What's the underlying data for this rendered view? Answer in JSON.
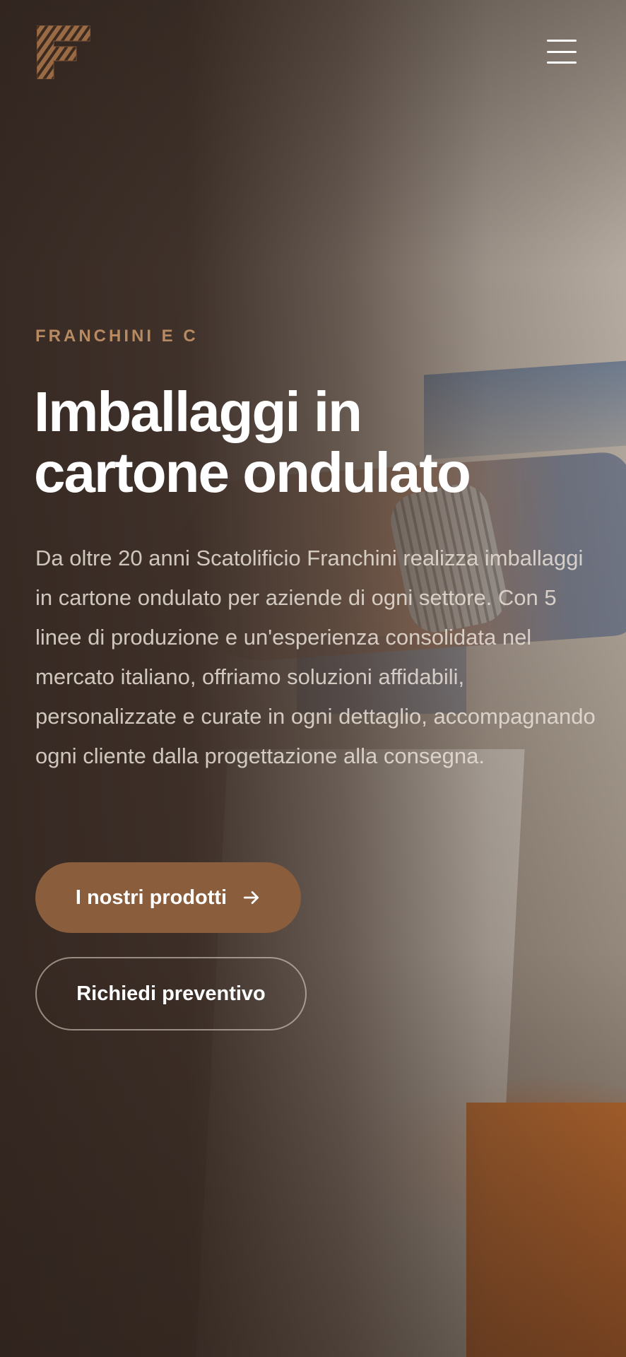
{
  "header": {
    "logo_icon": "franchini-logo-icon",
    "menu_icon": "hamburger-menu-icon"
  },
  "hero": {
    "eyebrow": "FRANCHINI E C",
    "title_line1": "Imballaggi in",
    "title_line2": "cartone ondulato",
    "description": "Da oltre 20 anni Scatolificio Franchini realizza imballaggi in cartone ondulato per aziende di ogni settore. Con 5 linee di produzione e un'esperienza consolidata nel mercato italiano, offriamo soluzioni affidabili, personalizzate e curate in ogni dettaglio, accompagnando ogni cliente dalla progettazione alla consegna.",
    "primary_button": "I nostri prodotti",
    "primary_button_icon": "arrow-right-icon",
    "secondary_button": "Richiedi preventivo"
  },
  "colors": {
    "accent": "#8a5d3c",
    "eyebrow": "#b88a62",
    "background_dark": "#3b2c24"
  }
}
